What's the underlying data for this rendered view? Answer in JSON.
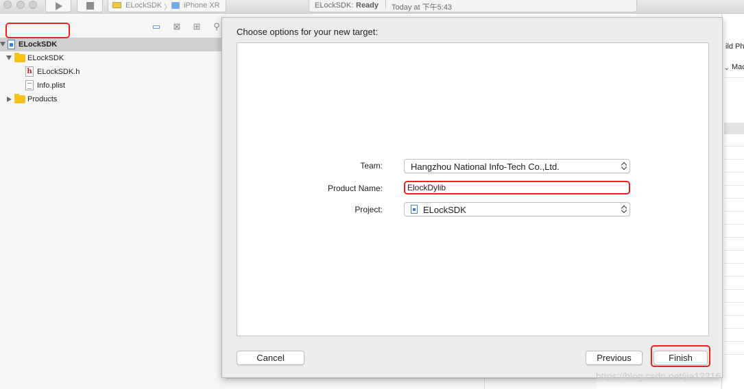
{
  "toolbar": {
    "scheme_target": "ELockSDK",
    "scheme_device": "iPhone XR",
    "status_project": "ELockSDK:",
    "status_state": "Ready",
    "status_time": "Today at 下午5:43"
  },
  "navigator": {
    "tabs": [
      "folder-icon",
      "source-control-icon",
      "symbol-icon",
      "search-icon"
    ],
    "items": [
      {
        "label": "ELockSDK",
        "kind": "project",
        "selected": true
      },
      {
        "label": "ELockSDK",
        "kind": "group"
      },
      {
        "label": "ELockSDK.h",
        "kind": "header-file"
      },
      {
        "label": "Info.plist",
        "kind": "plist-file"
      },
      {
        "label": "Products",
        "kind": "group"
      }
    ]
  },
  "background_editor": {
    "build_phases_fragment": "ild Ph",
    "platform_fragment": "Mac"
  },
  "sheet": {
    "title": "Choose options for your new target:",
    "fields": {
      "team_label": "Team:",
      "team_value": "Hangzhou National Info-Tech Co.,Ltd.",
      "product_name_label": "Product Name:",
      "product_name_value": "ElockDylib",
      "project_label": "Project:",
      "project_value": "ELockSDK"
    },
    "buttons": {
      "cancel": "Cancel",
      "previous": "Previous",
      "finish": "Finish"
    }
  },
  "highlight_color": "#e8231f",
  "watermark": "https://blog.csdn.net/jia12216"
}
